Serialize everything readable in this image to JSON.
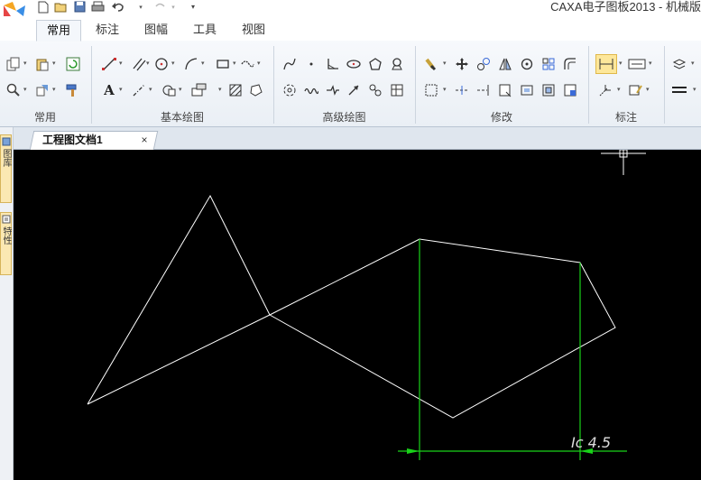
{
  "window": {
    "title": "CAXA电子图板2013 - 机械版",
    "logo_icon": "caxa-logo-icon"
  },
  "quick_access": [
    "new-file-icon",
    "open-file-icon",
    "save-icon",
    "print-icon",
    "undo-icon",
    "redo-icon",
    "customize-quick-access-icon"
  ],
  "tabs": [
    {
      "label": "常用",
      "active": true
    },
    {
      "label": "标注",
      "active": false
    },
    {
      "label": "图幅",
      "active": false
    },
    {
      "label": "工具",
      "active": false
    },
    {
      "label": "视图",
      "active": false
    }
  ],
  "ribbon_groups": [
    {
      "label": "常用"
    },
    {
      "label": "基本绘图"
    },
    {
      "label": "高级绘图"
    },
    {
      "label": "修改"
    },
    {
      "label": "标注"
    }
  ],
  "text_tool_label": "A",
  "left_panel": {
    "tab1_label": "图库",
    "tab2_label": "特性"
  },
  "document": {
    "tab_title": "工程图文档1",
    "close_glyph": "×"
  },
  "canvas": {
    "background": "#000000",
    "line_color": "#ffffff",
    "dimension_color": "#19d219",
    "crosshair_color": "#ffffff",
    "watermark_text": "Ic 4.5"
  },
  "colors": {
    "active_tab_bg": "#f4f7fb",
    "ribbon_bg": "#eef2f7",
    "highlight": "#fde79a"
  }
}
